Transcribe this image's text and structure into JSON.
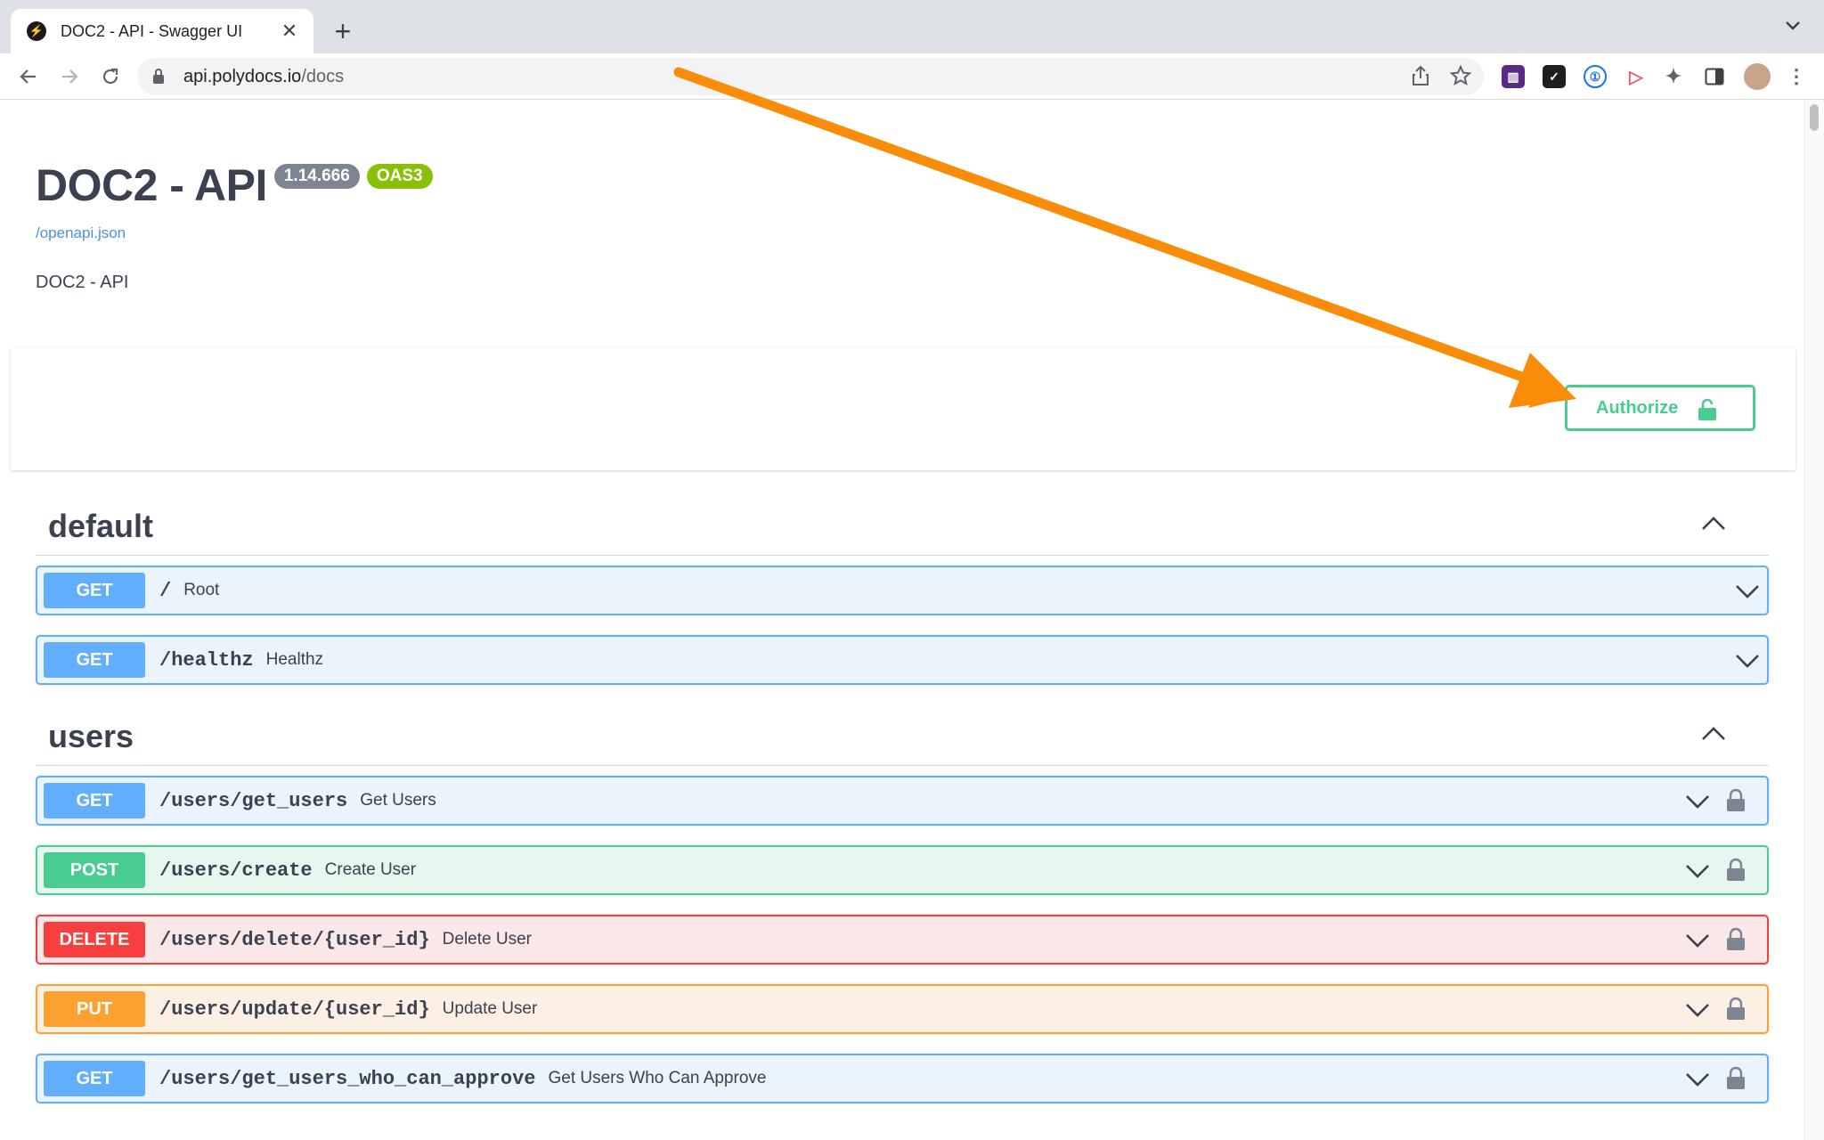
{
  "browser": {
    "tab_title": "DOC2 - API - Swagger UI",
    "url_host": "api.polydocs.io",
    "url_path": "/docs"
  },
  "api": {
    "title": "DOC2 - API",
    "version": "1.14.666",
    "oas_badge": "OAS3",
    "spec_link": "/openapi.json",
    "description": "DOC2 - API"
  },
  "authorize": {
    "label": "Authorize"
  },
  "colors": {
    "get": "#61affe",
    "post": "#49cc90",
    "delete": "#f93e3e",
    "put": "#fca130",
    "annotation_arrow": "#f98d0a"
  },
  "sections": [
    {
      "title": "default",
      "operations": [
        {
          "method": "GET",
          "path": "/",
          "summary": "Root"
        },
        {
          "method": "GET",
          "path": "/healthz",
          "summary": "Healthz"
        }
      ]
    },
    {
      "title": "users",
      "operations": [
        {
          "method": "GET",
          "path": "/users/get_users",
          "summary": "Get Users"
        },
        {
          "method": "POST",
          "path": "/users/create",
          "summary": "Create User"
        },
        {
          "method": "DELETE",
          "path": "/users/delete/{user_id}",
          "summary": "Delete User"
        },
        {
          "method": "PUT",
          "path": "/users/update/{user_id}",
          "summary": "Update User"
        },
        {
          "method": "GET",
          "path": "/users/get_users_who_can_approve",
          "summary": "Get Users Who Can Approve"
        }
      ]
    }
  ]
}
